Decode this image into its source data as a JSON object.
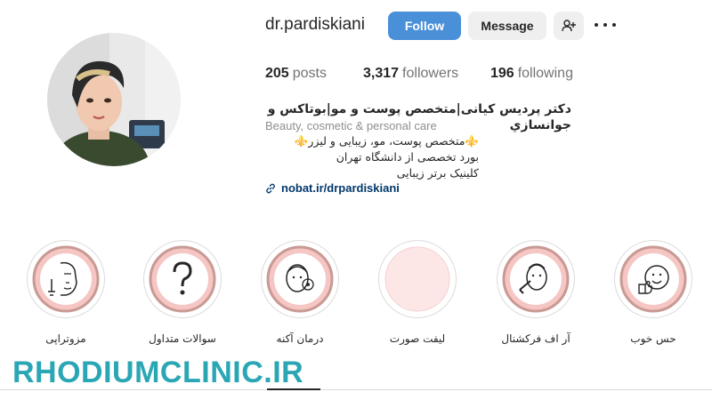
{
  "profile": {
    "username": "dr.pardiskiani",
    "avatar": "profile-photo"
  },
  "actions": {
    "follow_label": "Follow",
    "message_label": "Message",
    "add_user_icon": "person-plus-icon",
    "more_icon": "ellipsis-icon"
  },
  "stats": {
    "posts_count": "205",
    "posts_label": "posts",
    "followers_count": "3,317",
    "followers_label": "followers",
    "following_count": "196",
    "following_label": "following"
  },
  "bio": {
    "name": "دکتر پردیس کیانی|متخصص پوست و مو|بوتاکس و جوانسازي",
    "category": "Beauty, cosmetic & personal care",
    "line1": "⚜️متخصص پوست، مو، زیبایی و لیزر⚜️",
    "line2": "بورد تخصصی از دانشگاه تهران",
    "line3": "کلینیک برتر زیبایی",
    "link": "nobat.ir/drpardiskiani"
  },
  "highlights": [
    {
      "label": "حس خوب",
      "icon": "thumbs-up-smile-icon"
    },
    {
      "label": "آر اف فرکشنال",
      "icon": "face-rf-device-icon"
    },
    {
      "label": "لیفت صورت",
      "icon": ""
    },
    {
      "label": "درمان آکنه",
      "icon": "face-acne-icon"
    },
    {
      "label": "سوالات متداول",
      "icon": "question-mark-icon"
    },
    {
      "label": "مزوتراپی",
      "icon": "face-syringe-icon"
    }
  ],
  "watermark": "RHODIUMCLINIC.IR",
  "colors": {
    "follow_button": "#4a90d9",
    "highlight_ring": "#c99a94",
    "highlight_fill": "#f5c6c3",
    "watermark": "#2aa6b5",
    "link": "#00376b"
  }
}
